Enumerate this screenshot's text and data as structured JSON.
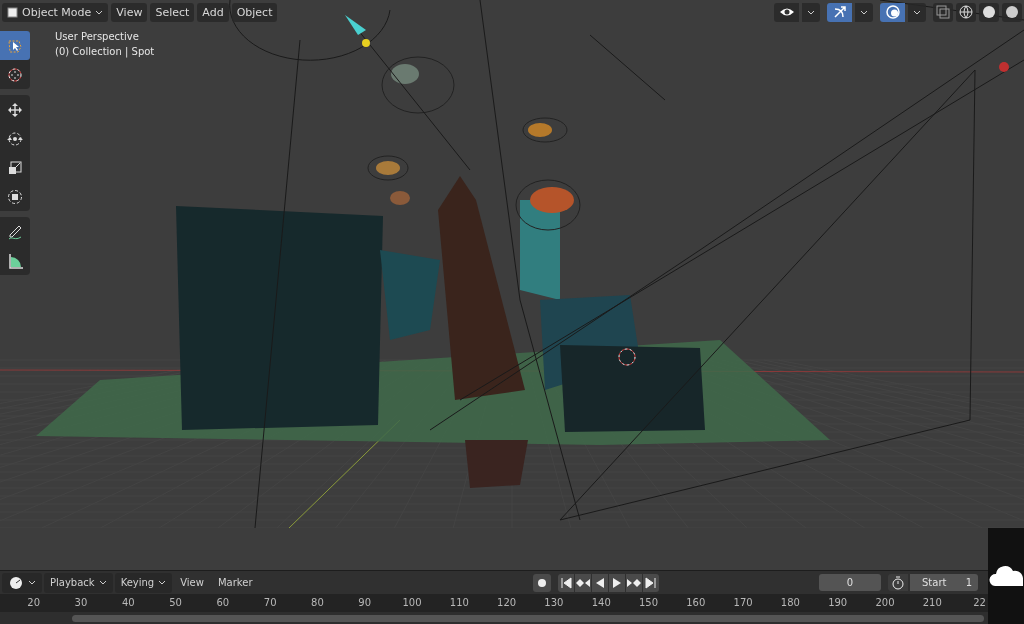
{
  "header": {
    "mode_menu": "Object Mode",
    "menus": [
      "View",
      "Select",
      "Add",
      "Object"
    ],
    "toggles": [
      {
        "kind": "visibility",
        "on": false
      },
      {
        "kind": "gizmo",
        "on": true
      },
      {
        "kind": "overlay",
        "on": true
      }
    ]
  },
  "viewport": {
    "info": [
      "User Perspective",
      "(0) Collection | Spot"
    ]
  },
  "toolbar": {
    "groups": [
      [
        {
          "kind": "select",
          "selected": true
        },
        {
          "kind": "cursor",
          "selected": false
        }
      ],
      [
        {
          "kind": "move",
          "selected": false
        },
        {
          "kind": "rotate",
          "selected": false
        },
        {
          "kind": "scale",
          "selected": false
        },
        {
          "kind": "transform",
          "selected": false
        }
      ],
      [
        {
          "kind": "annotate",
          "selected": false
        },
        {
          "kind": "measure",
          "selected": false
        }
      ]
    ]
  },
  "timeline": {
    "menus": [
      {
        "label": "Playback",
        "kind": "dropdown"
      },
      {
        "label": "Keying",
        "kind": "dropdown"
      },
      {
        "label": "View",
        "kind": "plain"
      },
      {
        "label": "Marker",
        "kind": "plain"
      }
    ],
    "current_frame": "0",
    "start_label": "Start",
    "start_value": "1",
    "ruler": [
      "20",
      "30",
      "40",
      "50",
      "60",
      "70",
      "80",
      "90",
      "100",
      "110",
      "120",
      "130",
      "140",
      "150",
      "160",
      "170",
      "180",
      "190",
      "200",
      "210",
      "22"
    ]
  }
}
